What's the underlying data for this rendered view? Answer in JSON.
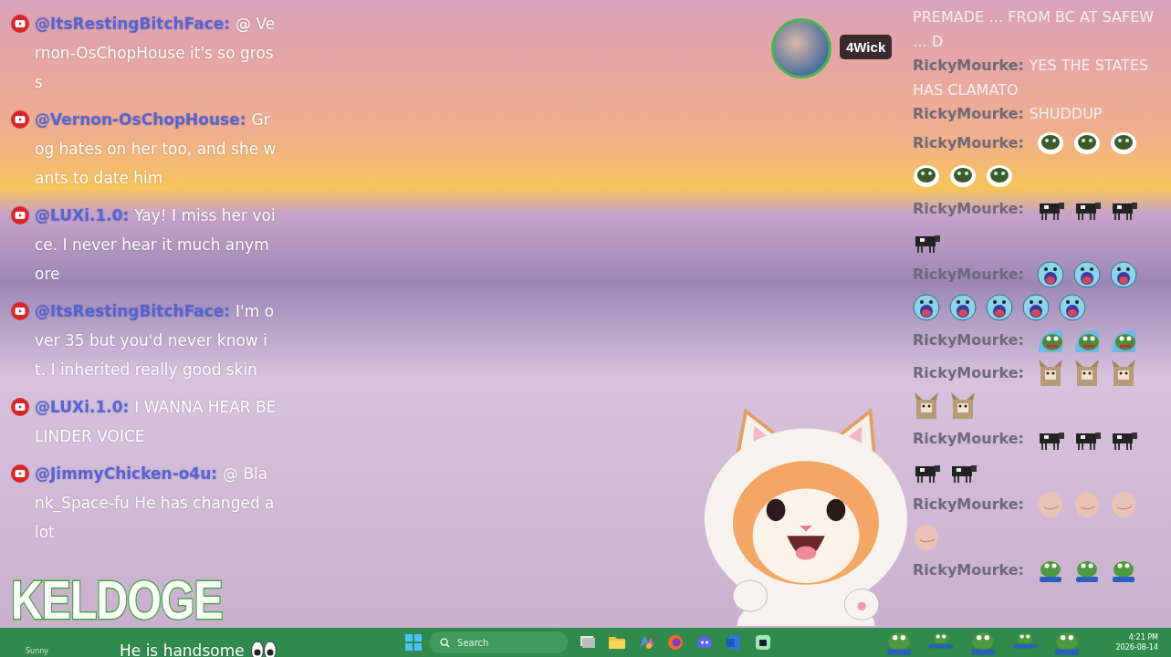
{
  "left_chat": {
    "messages": [
      {
        "username": "@ItsRestingBitchFace:",
        "text": "@ Vernon-OsChopHouse it's so gross"
      },
      {
        "username": "@Vernon-OsChopHouse:",
        "text": "Grog hates on her too, and she wants to date him"
      },
      {
        "username": "@LUXi.1.0:",
        "text": "Yay! I miss her voice. I never hear it much anymore"
      },
      {
        "username": "@ItsRestingBitchFace:",
        "text": "I'm over 35 but you'd never know it. I inherited really good skin"
      },
      {
        "username": "@LUXi.1.0:",
        "text": "I WANNA HEAR BELINDER VOICE"
      },
      {
        "username": "@JimmyChicken-o4u:",
        "text": "@ Blank_Space-fu He has changed a lot"
      },
      {
        "text": "He is handsome",
        "eyes": true
      }
    ]
  },
  "logo_text": "KELDOGE",
  "streamer": {
    "name": "4Wick"
  },
  "right_chat": {
    "messages": [
      {
        "text": "PREMADE … FROM BC AT SAFEW … D"
      },
      {
        "username": "RickyMourke:",
        "text": "YES THE STATES HAS CLAMATO"
      },
      {
        "username": "RickyMourke:",
        "text": "SHUDDUP"
      },
      {
        "username": "RickyMourke:",
        "emotes": [
          {
            "kind": "frog-bubble"
          },
          {
            "kind": "frog-bubble"
          },
          {
            "kind": "frog-bubble"
          },
          {
            "kind": "frog-bubble"
          },
          {
            "kind": "frog-bubble"
          },
          {
            "kind": "frog-bubble"
          }
        ]
      },
      {
        "username": "RickyMourke:",
        "emotes": [
          {
            "kind": "cow"
          },
          {
            "kind": "cow"
          },
          {
            "kind": "cow"
          },
          {
            "kind": "cow"
          }
        ]
      },
      {
        "username": "RickyMourke:",
        "emotes": [
          {
            "kind": "scream"
          },
          {
            "kind": "scream"
          },
          {
            "kind": "scream"
          },
          {
            "kind": "scream"
          },
          {
            "kind": "scream"
          },
          {
            "kind": "scream"
          },
          {
            "kind": "scream"
          },
          {
            "kind": "scream"
          }
        ]
      },
      {
        "username": "RickyMourke:",
        "emotes": [
          {
            "kind": "frog-wave"
          },
          {
            "kind": "frog-wave"
          },
          {
            "kind": "frog-wave"
          }
        ]
      },
      {
        "username": "RickyMourke:",
        "emotes": [
          {
            "kind": "cat"
          },
          {
            "kind": "cat"
          },
          {
            "kind": "cat"
          },
          {
            "kind": "cat"
          },
          {
            "kind": "cat"
          }
        ]
      },
      {
        "username": "RickyMourke:",
        "emotes": [
          {
            "kind": "cow"
          },
          {
            "kind": "cow"
          },
          {
            "kind": "cow"
          },
          {
            "kind": "cow"
          },
          {
            "kind": "cow"
          }
        ]
      },
      {
        "username": "RickyMourke:",
        "emotes": [
          {
            "kind": "blob"
          },
          {
            "kind": "blob"
          },
          {
            "kind": "blob"
          },
          {
            "kind": "blob"
          }
        ]
      },
      {
        "username": "RickyMourke:",
        "emotes": [
          {
            "kind": "frog-sit"
          },
          {
            "kind": "frog-sit"
          },
          {
            "kind": "frog-sit"
          }
        ]
      }
    ]
  },
  "taskbar": {
    "weather": "Sunny",
    "search": {
      "placeholder": "Search"
    },
    "apps": [
      {
        "kind": "window"
      },
      {
        "kind": "folder"
      },
      {
        "kind": "app"
      },
      {
        "kind": "browser"
      },
      {
        "kind": "chat"
      },
      {
        "kind": "document"
      },
      {
        "kind": "app2"
      }
    ],
    "tray_emotes": [
      {
        "kind": "frog-sit"
      },
      {
        "kind": "frog-small"
      },
      {
        "kind": "frog-sit"
      },
      {
        "kind": "frog-small"
      },
      {
        "kind": "frog-sit"
      }
    ],
    "time": "4:21 PM",
    "date": "2026-08-14"
  }
}
